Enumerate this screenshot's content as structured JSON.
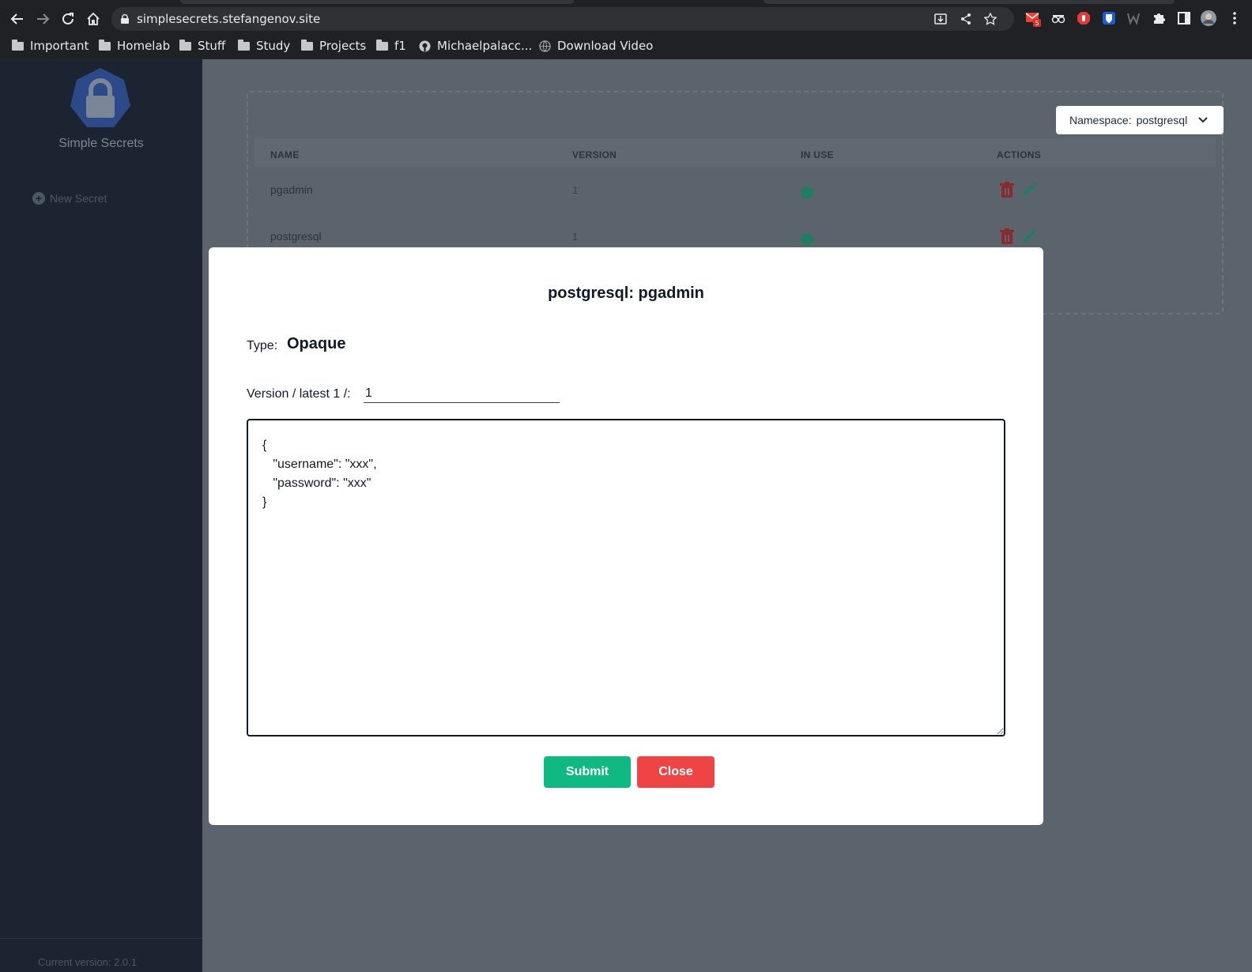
{
  "browser": {
    "url": "simplesecrets.stefangenov.site",
    "mail_badge": "5",
    "bookmarks": [
      "Important",
      "Homelab",
      "Stuff",
      "Study",
      "Projects",
      "f1",
      "Michaelpalacc...",
      "Download Video"
    ]
  },
  "sidebar": {
    "app_name": "Simple Secrets",
    "new_secret_label": "New Secret",
    "footer": "Current version: 2.0.1"
  },
  "main": {
    "namespace_label": "Namespace:",
    "namespace_value": "postgresql",
    "columns": [
      "NAME",
      "VERSION",
      "IN USE",
      "ACTIONS"
    ],
    "rows": [
      {
        "name": "pgadmin",
        "version": "1",
        "in_use": true
      },
      {
        "name": "postgresql",
        "version": "1",
        "in_use": true
      }
    ]
  },
  "modal": {
    "title": "postgresql: pgadmin",
    "type_label": "Type:",
    "type_value": "Opaque",
    "version_label": "Version / latest 1 /:",
    "version_value": "1",
    "secret_json": "{\n   \"username\": \"xxx\",\n   \"password\": \"xxx\"\n}",
    "submit_label": "Submit",
    "close_label": "Close"
  },
  "colors": {
    "sidebar_bg": "#1d2431",
    "main_bg": "#5b636d",
    "submit": "#10b981",
    "close": "#ef4444",
    "in_use_dot": "#1f7d63",
    "trash_icon": "#8a2b2b",
    "pencil_icon": "#1f7d63"
  }
}
